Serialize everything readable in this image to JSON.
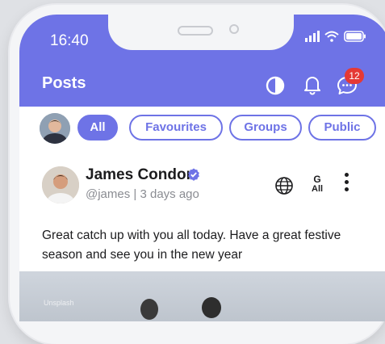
{
  "status_bar": {
    "time": "16:40"
  },
  "header": {
    "title": "Posts",
    "notification_count": "12"
  },
  "filters": {
    "chips": [
      {
        "label": "All",
        "active": true
      },
      {
        "label": "Favourites",
        "active": false
      },
      {
        "label": "Groups",
        "active": false
      },
      {
        "label": "Public",
        "active": false
      }
    ]
  },
  "post": {
    "author_name": "James Condor",
    "author_meta": "@james | 3 days ago",
    "audience_top": "G",
    "audience_bottom": "All",
    "text": "Great catch up with you all today.  Have a great festive season and see you in the new year",
    "image_caption": "Unsplash"
  },
  "colors": {
    "accent": "#6e73e6",
    "badge": "#e53935",
    "verified": "#6e73e6"
  }
}
